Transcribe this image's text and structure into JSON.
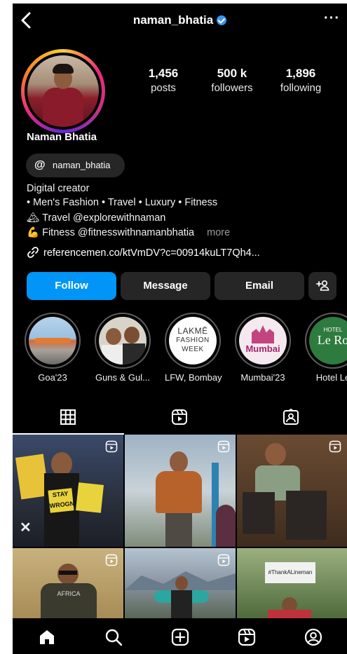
{
  "header": {
    "username": "naman_bhatia",
    "verified_icon": "verified-badge-icon",
    "more": "···"
  },
  "profile": {
    "name": "Naman Bhatia",
    "stats": [
      {
        "value": "1,456",
        "label": "posts"
      },
      {
        "value": "500 k",
        "label": "followers"
      },
      {
        "value": "1,896",
        "label": "following"
      }
    ],
    "threads_handle": "naman_bhatia",
    "threads_icon": "@",
    "bio": {
      "line1": "Digital creator",
      "line2": "• Men's Fashion • Travel • Luxury • Fitness",
      "line3": "🏔 Travel @explorewithnaman",
      "line4": "💪 Fitness @fitnesswithnamanbhatia",
      "more": "more",
      "link": "referencemen.co/ktVmDV?c=00914kuLT7Qh4..."
    }
  },
  "actions": {
    "follow": "Follow",
    "message": "Message",
    "email": "Email",
    "add_user_icon": "+👤"
  },
  "highlights": [
    {
      "label": "Goa'23"
    },
    {
      "label": "Guns & Gul..."
    },
    {
      "label": "LFW, Bombay",
      "art": [
        "LAKMĒ",
        "FASHION",
        "WEEK"
      ]
    },
    {
      "label": "Mumbai'23",
      "art": [
        "Mumbai"
      ]
    },
    {
      "label": "Hotel Le",
      "art": [
        "HOTEL",
        "Le Ro"
      ]
    }
  ],
  "posts": {
    "p1_sign1": "STAY",
    "p1_sign2": "WROGN",
    "p7_sign": "#ThankALineman",
    "p4_shirt": "AFRICA"
  },
  "colors": {
    "accent": "#0095f6",
    "surface": "#262626"
  }
}
